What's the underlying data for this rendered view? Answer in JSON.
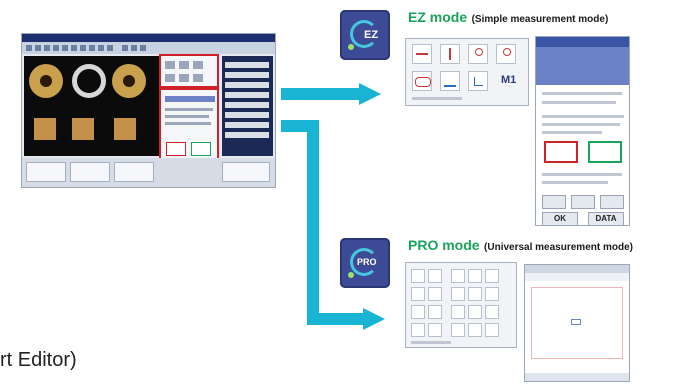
{
  "ez": {
    "icon_text": "EZ",
    "title": "EZ mode",
    "subtitle": "(Simple measurement mode)",
    "tool_label": "M1",
    "ok_button": "OK",
    "data_button": "DATA"
  },
  "pro": {
    "icon_text": "PRO",
    "title": "PRO mode",
    "subtitle": "(Universal measurement mode)"
  },
  "caption": "rt Editor)",
  "colors": {
    "arrow": "#19b4d4",
    "ez_title": "#1aa35a",
    "icon_bg": "#3d4a95",
    "highlight": "#d0202a"
  }
}
